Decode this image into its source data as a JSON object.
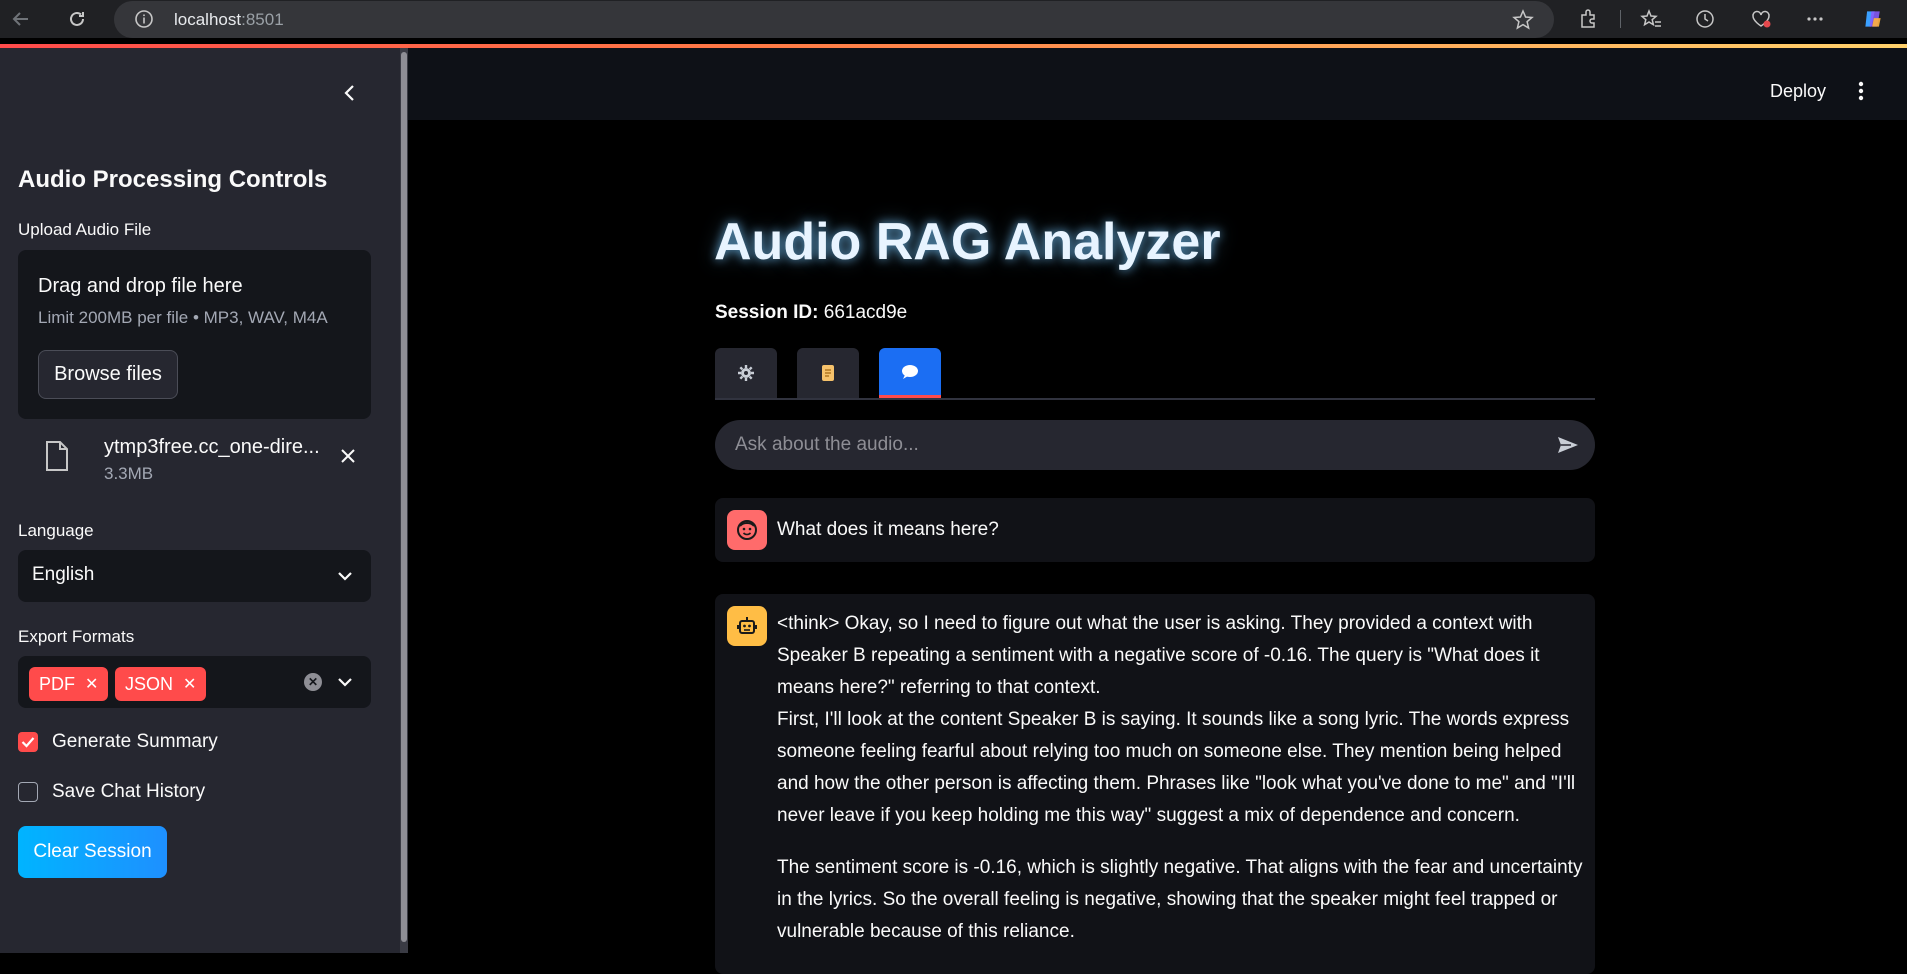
{
  "browser": {
    "url_host": "localhost",
    "url_port": ":8501"
  },
  "header": {
    "deploy_label": "Deploy"
  },
  "sidebar": {
    "title": "Audio Processing Controls",
    "upload_label": "Upload Audio File",
    "dropzone_title": "Drag and drop file here",
    "dropzone_limits": "Limit 200MB per file • MP3, WAV, M4A",
    "browse_label": "Browse files",
    "file_name": "ytmp3free.cc_one-dire...",
    "file_size": "3.3MB",
    "language_label": "Language",
    "language_value": "English",
    "export_label": "Export Formats",
    "export_tags": [
      "PDF",
      "JSON"
    ],
    "generate_summary_label": "Generate Summary",
    "generate_summary_checked": true,
    "save_history_label": "Save Chat History",
    "save_history_checked": false,
    "clear_label": "Clear Session"
  },
  "main": {
    "title": "Audio RAG Analyzer",
    "session_label": "Session ID:",
    "session_value": "661acd9e",
    "tabs": [
      {
        "icon": "gear-icon",
        "active": false
      },
      {
        "icon": "scroll-icon",
        "active": false
      },
      {
        "icon": "speech-bubble-icon",
        "active": true
      }
    ],
    "chat_placeholder": "Ask about the audio...",
    "messages": [
      {
        "role": "user",
        "paragraphs": [
          "What does it means here?"
        ]
      },
      {
        "role": "assistant",
        "paragraphs": [
          "<think> Okay, so I need to figure out what the user is asking. They provided a context with Speaker B repeating a sentiment with a negative score of -0.16. The query is \"What does it means here?\" referring to that context.",
          "First, I'll look at the content Speaker B is saying. It sounds like a song lyric. The words express someone feeling fearful about relying too much on someone else. They mention being helped and how the other person is affecting them. Phrases like \"look what you've done to me\" and \"I'll never leave if you keep holding me this way\" suggest a mix of dependence and concern.",
          "The sentiment score is -0.16, which is slightly negative. That aligns with the fear and uncertainty in the lyrics. So the overall feeling is negative, showing that the speaker might feel trapped or vulnerable because of this reliance."
        ]
      }
    ]
  },
  "colors": {
    "accent": "#ff4b4b",
    "sidebar_bg": "#262730",
    "main_bg": "#000000",
    "user_avatar": "#ff6b6b",
    "assistant_avatar": "#ffbd45"
  }
}
